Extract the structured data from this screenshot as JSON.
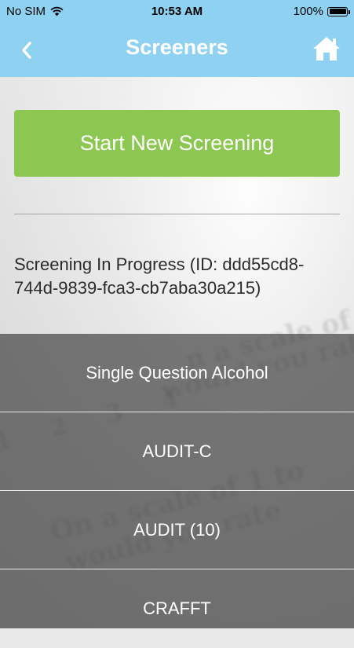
{
  "status_bar": {
    "carrier": "No SIM",
    "time": "10:53 AM",
    "battery": "100%",
    "icons": [
      "wifi-icon",
      "battery-icon"
    ]
  },
  "header": {
    "title": "Screeners",
    "back_icon": "chevron-left-icon",
    "home_icon": "home-icon"
  },
  "main": {
    "start_button_label": "Start New Screening",
    "in_progress_text": "Screening In Progress (ID: ddd55cd8-744d-9839-fca3-cb7aba30a215)"
  },
  "screeners": [
    {
      "label": "Single Question Alcohol"
    },
    {
      "label": "AUDIT-C"
    },
    {
      "label": "AUDIT (10)"
    },
    {
      "label": "CRAFFT"
    }
  ],
  "colors": {
    "header": "#8fd1f0",
    "start_button": "#8cc752",
    "overlay": "#464646"
  }
}
